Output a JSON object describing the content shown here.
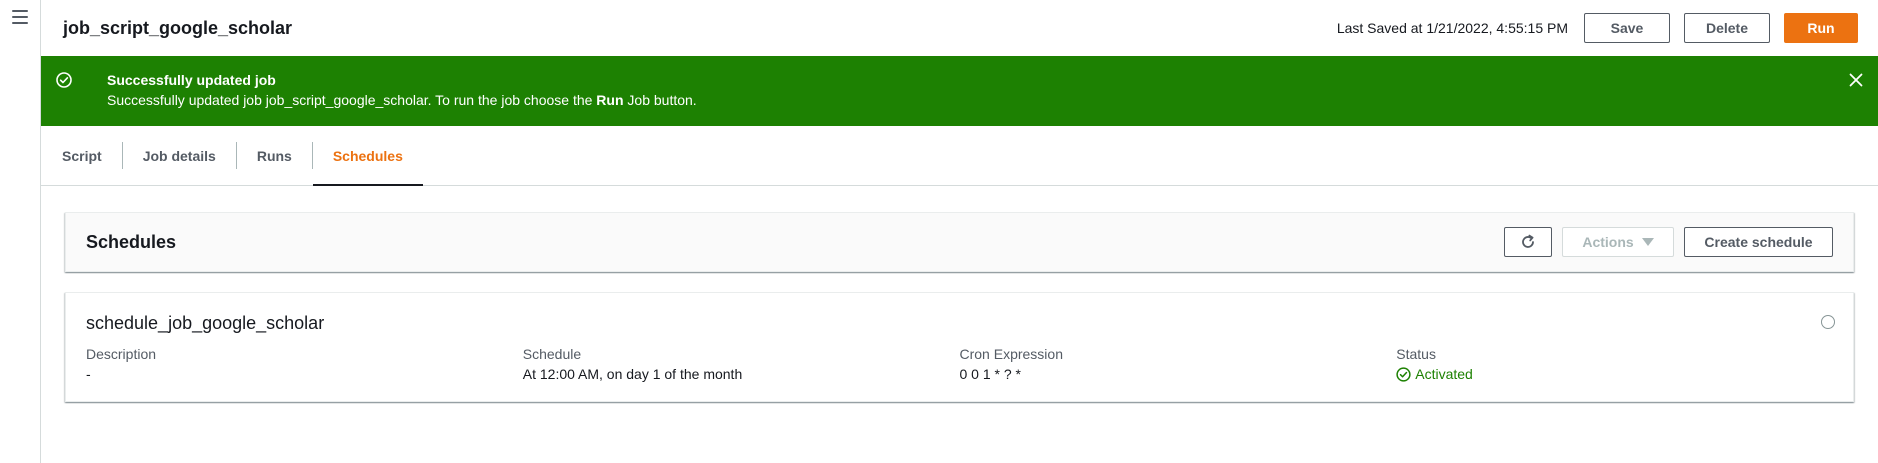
{
  "header": {
    "job_title": "job_script_google_scholar",
    "last_saved": "Last Saved at 1/21/2022, 4:55:15 PM",
    "save_label": "Save",
    "delete_label": "Delete",
    "run_label": "Run"
  },
  "flash": {
    "title": "Successfully updated job",
    "message_prefix": "Successfully updated job job_script_google_scholar. To run the job choose the ",
    "message_bold": "Run",
    "message_suffix": " Job button.",
    "icon": "check-circle-icon",
    "close_icon": "close-icon"
  },
  "tabs": [
    {
      "label": "Script"
    },
    {
      "label": "Job details"
    },
    {
      "label": "Runs"
    },
    {
      "label": "Schedules",
      "active": true
    }
  ],
  "schedules_panel": {
    "title": "Schedules",
    "refresh_icon": "refresh-icon",
    "actions_label": "Actions",
    "create_label": "Create schedule"
  },
  "schedule_card": {
    "name": "schedule_job_google_scholar",
    "description_label": "Description",
    "description_value": "-",
    "schedule_label": "Schedule",
    "schedule_value": "At 12:00 AM, on day 1 of the month",
    "cron_label": "Cron Expression",
    "cron_value": "0 0 1 * ? *",
    "status_label": "Status",
    "status_value": "Activated"
  },
  "colors": {
    "accent": "#ec7211",
    "success": "#1d8102",
    "text": "#16191f",
    "muted": "#545b64"
  }
}
